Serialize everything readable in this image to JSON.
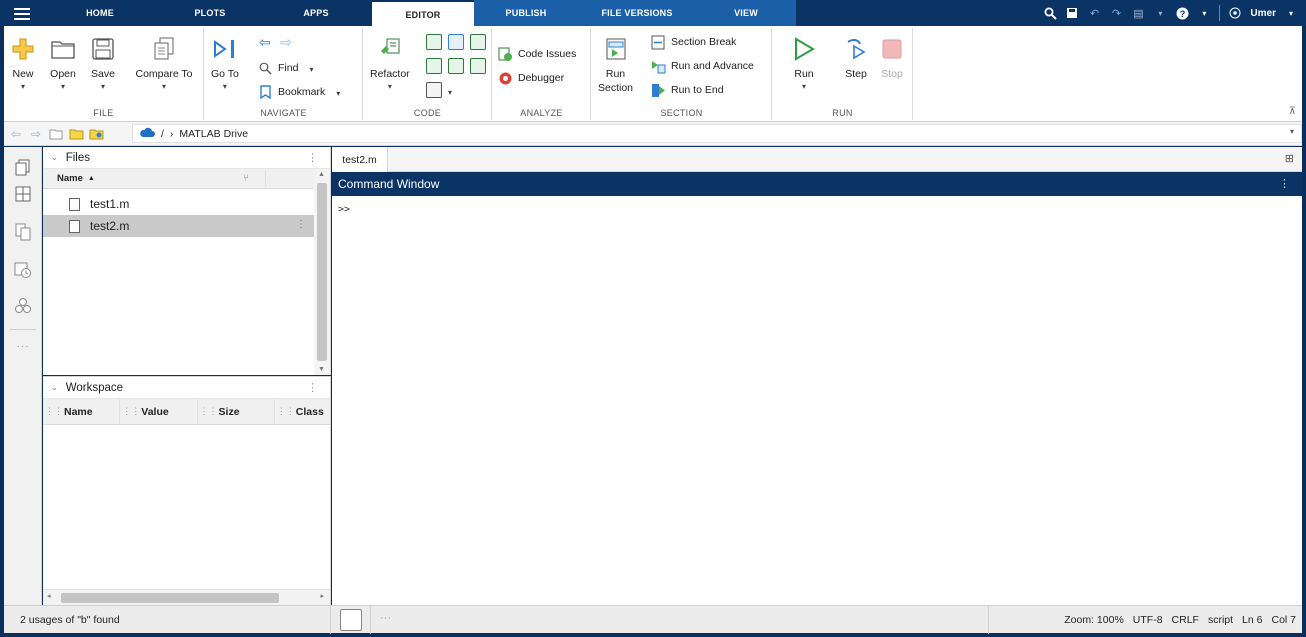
{
  "tabs": [
    {
      "label": "HOME",
      "state": "normal"
    },
    {
      "label": "PLOTS",
      "state": "normal"
    },
    {
      "label": "APPS",
      "state": "normal"
    },
    {
      "label": "EDITOR",
      "state": "active"
    },
    {
      "label": "PUBLISH",
      "state": "blue"
    },
    {
      "label": "FILE VERSIONS",
      "state": "blue"
    },
    {
      "label": "VIEW",
      "state": "blue"
    }
  ],
  "user": {
    "name": "Umer"
  },
  "ribbon": {
    "file": {
      "label": "FILE",
      "new": "New",
      "open": "Open",
      "save": "Save",
      "compare": "Compare To"
    },
    "navigate": {
      "label": "NAVIGATE",
      "goto": "Go To",
      "find": "Find",
      "bookmark": "Bookmark"
    },
    "code": {
      "label": "CODE",
      "refactor": "Refactor"
    },
    "analyze": {
      "label": "ANALYZE",
      "code_issues": "Code Issues",
      "debugger": "Debugger"
    },
    "section": {
      "label": "SECTION",
      "run_section_1": "Run",
      "run_section_2": "Section",
      "section_break": "Section Break",
      "run_and_advance": "Run and Advance",
      "run_to_end": "Run to End"
    },
    "run": {
      "label": "RUN",
      "run": "Run",
      "step": "Step",
      "stop": "Stop"
    }
  },
  "address": {
    "separator": "/",
    "chevron": "›",
    "path": "MATLAB Drive"
  },
  "files_panel": {
    "title": "Files",
    "column_name": "Name",
    "files": [
      {
        "name": "test1.m",
        "selected": false
      },
      {
        "name": "test2.m",
        "selected": true
      }
    ]
  },
  "workspace_panel": {
    "title": "Workspace",
    "columns": [
      "Name",
      "Value",
      "Size",
      "Class"
    ]
  },
  "editor": {
    "tab": "test2.m"
  },
  "command_window": {
    "title": "Command Window",
    "prompt": ">>"
  },
  "status": {
    "message": "2 usages of \"b\" found",
    "zoom": "Zoom: 100%",
    "encoding": "UTF-8",
    "line_ending": "CRLF",
    "type": "script",
    "ln": "Ln 6",
    "col": "Col 7"
  },
  "colors": {
    "title_bar": "#0b3466",
    "active_tab_bg": "#ffffff",
    "secondary_tabs": "#1a5fa8",
    "run_green": "#2e9e46",
    "stop_red": "#f0b8b8"
  }
}
